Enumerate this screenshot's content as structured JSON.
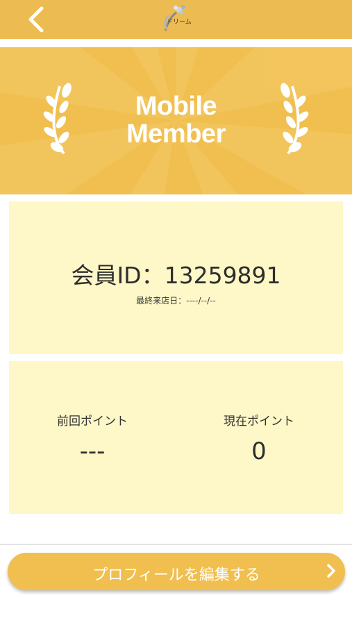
{
  "header": {
    "back_icon": "chevron-left-icon",
    "logo_text": "ドリーム",
    "background": "#ecbb52"
  },
  "banner": {
    "title_line1": "Mobile",
    "title_line2": "Member",
    "background": "#f0bf4f",
    "icons": [
      "laurel-left-icon",
      "laurel-right-icon"
    ]
  },
  "member": {
    "id_text": "会員ID：13259891",
    "last_visit": "最終来店日：----/--/--",
    "card_color": "#fef7c7"
  },
  "points": {
    "previous_label": "前回ポイント",
    "previous_value": "---",
    "current_label": "現在ポイント",
    "current_value": "0"
  },
  "actions": {
    "edit_profile_label": "プロフィールを編集する",
    "edit_icon": "chevron-right-icon",
    "button_color": "#f0bf4f"
  }
}
